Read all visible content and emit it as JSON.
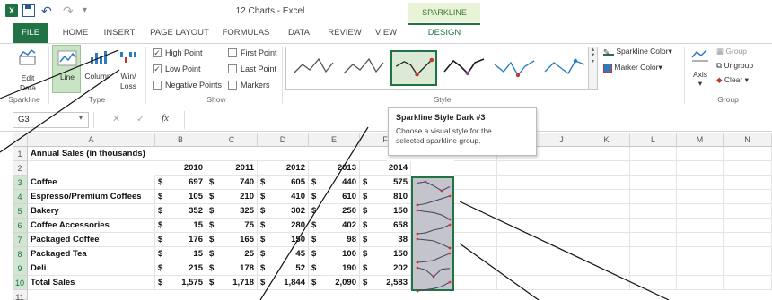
{
  "window": {
    "title": "12 Charts - Excel",
    "contextual_tab_title": "SPARKLINE TOOLS"
  },
  "tabs": [
    "FILE",
    "HOME",
    "INSERT",
    "PAGE LAYOUT",
    "FORMULAS",
    "DATA",
    "REVIEW",
    "VIEW",
    "DESIGN"
  ],
  "ribbon": {
    "sparkline_group": {
      "edit_data_line1": "Edit",
      "edit_data_line2": "Data",
      "label": "Sparkline"
    },
    "type_group": {
      "line": "Line",
      "column": "Column",
      "winloss_line1": "Win/",
      "winloss_line2": "Loss",
      "label": "Type"
    },
    "show_group": {
      "high_point": "High Point",
      "low_point": "Low Point",
      "negative_points": "Negative Points",
      "first_point": "First Point",
      "last_point": "Last Point",
      "markers": "Markers",
      "high_point_checked": true,
      "low_point_checked": true,
      "label": "Show"
    },
    "style_group": {
      "label": "Style",
      "selected_index": 2
    },
    "colors": {
      "sparkline_color": "Sparkline Color",
      "marker_color": "Marker Color"
    },
    "group_group": {
      "axis": "Axis",
      "group": "Group",
      "ungroup": "Ungroup",
      "clear": "Clear",
      "label": "Group"
    }
  },
  "formula_bar": {
    "name_box": "G3",
    "fx": "fx",
    "cancel": "✕",
    "enter": "✓"
  },
  "tooltip": {
    "title": "Sparkline Style Dark #3",
    "line1": "Choose a visual style for the",
    "line2": "selected sparkline group."
  },
  "sheet": {
    "columns": [
      "A",
      "B",
      "C",
      "D",
      "E",
      "F",
      "G",
      "H",
      "I",
      "J",
      "K",
      "L",
      "M",
      "N"
    ],
    "rows": [
      "1",
      "2",
      "3",
      "4",
      "5",
      "6",
      "7",
      "8",
      "9",
      "10",
      "11"
    ],
    "a1": "Annual Sales (in thousands)",
    "years": [
      "2010",
      "2011",
      "2012",
      "2013",
      "2014"
    ],
    "dollar": "$",
    "data": [
      {
        "label": "Coffee",
        "values": [
          "697",
          "740",
          "605",
          "440",
          "575"
        ]
      },
      {
        "label": "Espresso/Premium Coffees",
        "values": [
          "105",
          "210",
          "410",
          "610",
          "810"
        ]
      },
      {
        "label": "Bakery",
        "values": [
          "352",
          "325",
          "302",
          "250",
          "150"
        ]
      },
      {
        "label": "Coffee Accessories",
        "values": [
          "15",
          "75",
          "280",
          "402",
          "658"
        ]
      },
      {
        "label": "Packaged Coffee",
        "values": [
          "176",
          "165",
          "150",
          "98",
          "38"
        ]
      },
      {
        "label": "Packaged Tea",
        "values": [
          "15",
          "25",
          "45",
          "100",
          "150"
        ]
      },
      {
        "label": "Deli",
        "values": [
          "215",
          "178",
          "52",
          "190",
          "202"
        ]
      },
      {
        "label": "Total Sales",
        "values": [
          "1,575",
          "1,718",
          "1,844",
          "2,090",
          "2,583"
        ]
      }
    ]
  },
  "colors": {
    "accent": "#217346",
    "file_tab": "#217346",
    "contextual": "#e8f3d8",
    "sparkline": "#4a4a6a",
    "marker_high": "#d23c3c",
    "marker_low": "#c03030"
  }
}
